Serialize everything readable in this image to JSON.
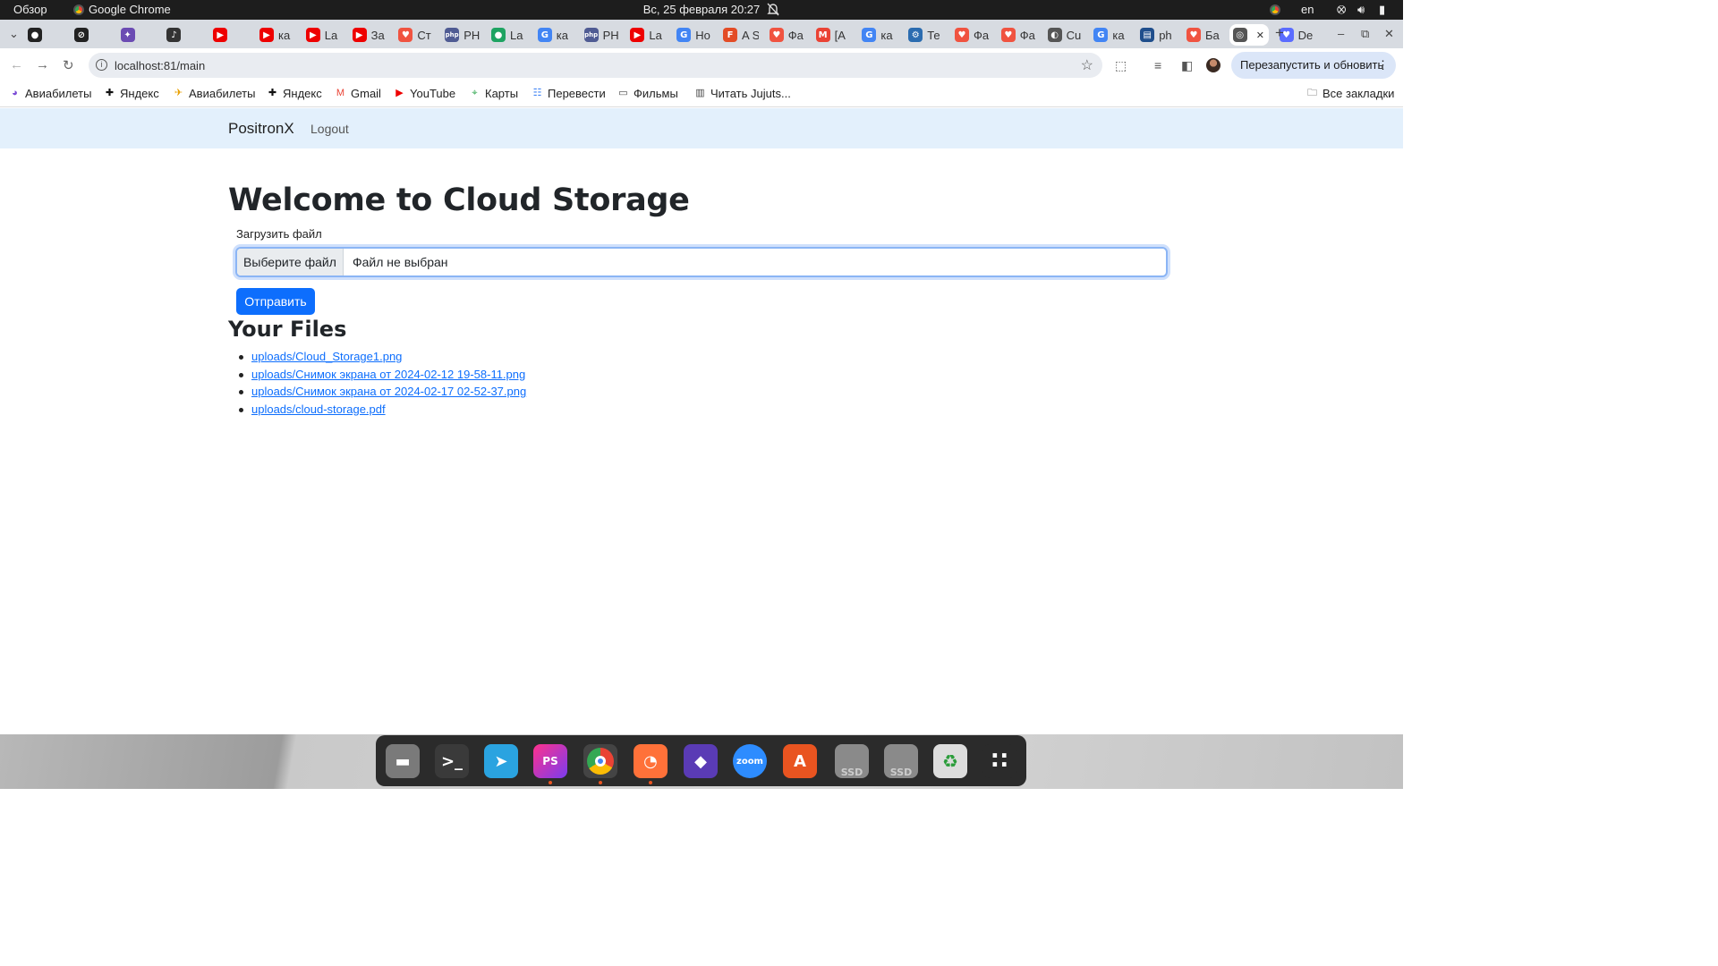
{
  "topbar": {
    "overview": "Обзор",
    "app_name": "Google Chrome",
    "clock": "Вс, 25 февраля  20:27",
    "lang": "en"
  },
  "tabs": [
    {
      "label": "",
      "icon": "github-icon",
      "color": "#222"
    },
    {
      "label": "",
      "icon": "blocked-icon",
      "color": "#222"
    },
    {
      "label": "",
      "icon": "app-icon",
      "color": "#6b4bb3"
    },
    {
      "label": "",
      "icon": "speaker-icon",
      "color": "#333"
    },
    {
      "label": "",
      "icon": "youtube-icon",
      "color": "#e00"
    },
    {
      "label": "ка",
      "icon": "youtube-icon",
      "color": "#e00"
    },
    {
      "label": "La",
      "icon": "youtube-icon",
      "color": "#e00"
    },
    {
      "label": "За",
      "icon": "youtube-icon",
      "color": "#e00"
    },
    {
      "label": "Ст",
      "icon": "laravel-icon",
      "color": "#f05340"
    },
    {
      "label": "PH",
      "icon": "php-icon",
      "color": "#4f5b93"
    },
    {
      "label": "La",
      "icon": "green-icon",
      "color": "#1ea362"
    },
    {
      "label": "ка",
      "icon": "google-icon",
      "color": "#4285f4"
    },
    {
      "label": "PH",
      "icon": "php-icon",
      "color": "#4f5b93"
    },
    {
      "label": "La",
      "icon": "youtube-icon",
      "color": "#e00"
    },
    {
      "label": "Но",
      "icon": "google-icon",
      "color": "#4285f4"
    },
    {
      "label": "A S",
      "icon": "doc-icon",
      "color": "#e34c26"
    },
    {
      "label": "Фа",
      "icon": "laravel-icon",
      "color": "#f05340"
    },
    {
      "label": "[A",
      "icon": "gmail-icon",
      "color": "#ea4335"
    },
    {
      "label": "ка",
      "icon": "google-icon",
      "color": "#4285f4"
    },
    {
      "label": "Те",
      "icon": "gear-icon",
      "color": "#2b6cb0"
    },
    {
      "label": "Фа",
      "icon": "laravel-icon",
      "color": "#f05340"
    },
    {
      "label": "Фа",
      "icon": "laravel-icon",
      "color": "#f05340"
    },
    {
      "label": "Cu",
      "icon": "cu-icon",
      "color": "#555"
    },
    {
      "label": "ка",
      "icon": "google-icon",
      "color": "#4285f4"
    },
    {
      "label": "ph",
      "icon": "docs-icon",
      "color": "#1f4e8c"
    },
    {
      "label": "Ба",
      "icon": "laravel-icon",
      "color": "#f05340"
    },
    {
      "label": "",
      "icon": "globe-icon",
      "color": "#555",
      "active": true
    },
    {
      "label": "De",
      "icon": "de-icon",
      "color": "#5b6cff"
    }
  ],
  "address": {
    "url": "localhost:81/main"
  },
  "relaunch_label": "Перезапустить и обновить",
  "bookmarks": [
    {
      "label": "Авиабилеты",
      "icon": "aviasales-icon"
    },
    {
      "label": "Яндекс",
      "icon": "yandex-icon"
    },
    {
      "label": "Авиабилеты",
      "icon": "plane-icon"
    },
    {
      "label": "Яндекс",
      "icon": "yandex-icon"
    },
    {
      "label": "Gmail",
      "icon": "gmail-icon"
    },
    {
      "label": "YouTube",
      "icon": "youtube-icon"
    },
    {
      "label": "Карты",
      "icon": "maps-pin-icon"
    },
    {
      "label": "Перевести",
      "icon": "translate-icon"
    },
    {
      "label": "Фильмы",
      "icon": "folder-icon"
    },
    {
      "label": "Читать Jujuts...",
      "icon": "book-icon"
    }
  ],
  "all_bookmarks": "Все закладки",
  "site": {
    "brand": "PositronX",
    "logout": "Logout",
    "heading": "Welcome to Cloud Storage",
    "upload_label": "Загрузить файл",
    "choose_file": "Выберите файл",
    "no_file": "Файл не выбран",
    "submit": "Отправить",
    "files_heading": "Your Files",
    "files": [
      "uploads/Cloud_Storage1.png",
      "uploads/Снимок экрана от 2024-02-12 19-58-11.png",
      "uploads/Снимок экрана от 2024-02-17 02-52-37.png",
      "uploads/cloud-storage.pdf"
    ]
  },
  "dock": {
    "apps": [
      {
        "name": "files-icon",
        "color": "#7a7a7a"
      },
      {
        "name": "terminal-icon",
        "color": "#3a3a3a"
      },
      {
        "name": "telegram-icon",
        "color": "#2aa3e0"
      },
      {
        "name": "phpstorm-icon",
        "color": "#9b3fd0",
        "running": true
      },
      {
        "name": "chrome-icon",
        "color": "#555",
        "running": true
      },
      {
        "name": "firefox-icon",
        "color": "#ff7139",
        "running": true
      },
      {
        "name": "obsidian-icon",
        "color": "#5a3bb5"
      },
      {
        "name": "zoom-icon",
        "color": "#2d8cff"
      },
      {
        "name": "app-center-icon",
        "color": "#e95420"
      },
      {
        "name": "ssd-icon",
        "color": "#8a8a8a"
      },
      {
        "name": "ssd-icon",
        "color": "#8a8a8a"
      },
      {
        "name": "trash-icon",
        "color": "#ddd"
      },
      {
        "name": "app-grid-icon",
        "color": "#2b2b2b"
      }
    ],
    "zoom_label": "zoom",
    "ssd_label": "SSD",
    "ps_label": "PS"
  }
}
